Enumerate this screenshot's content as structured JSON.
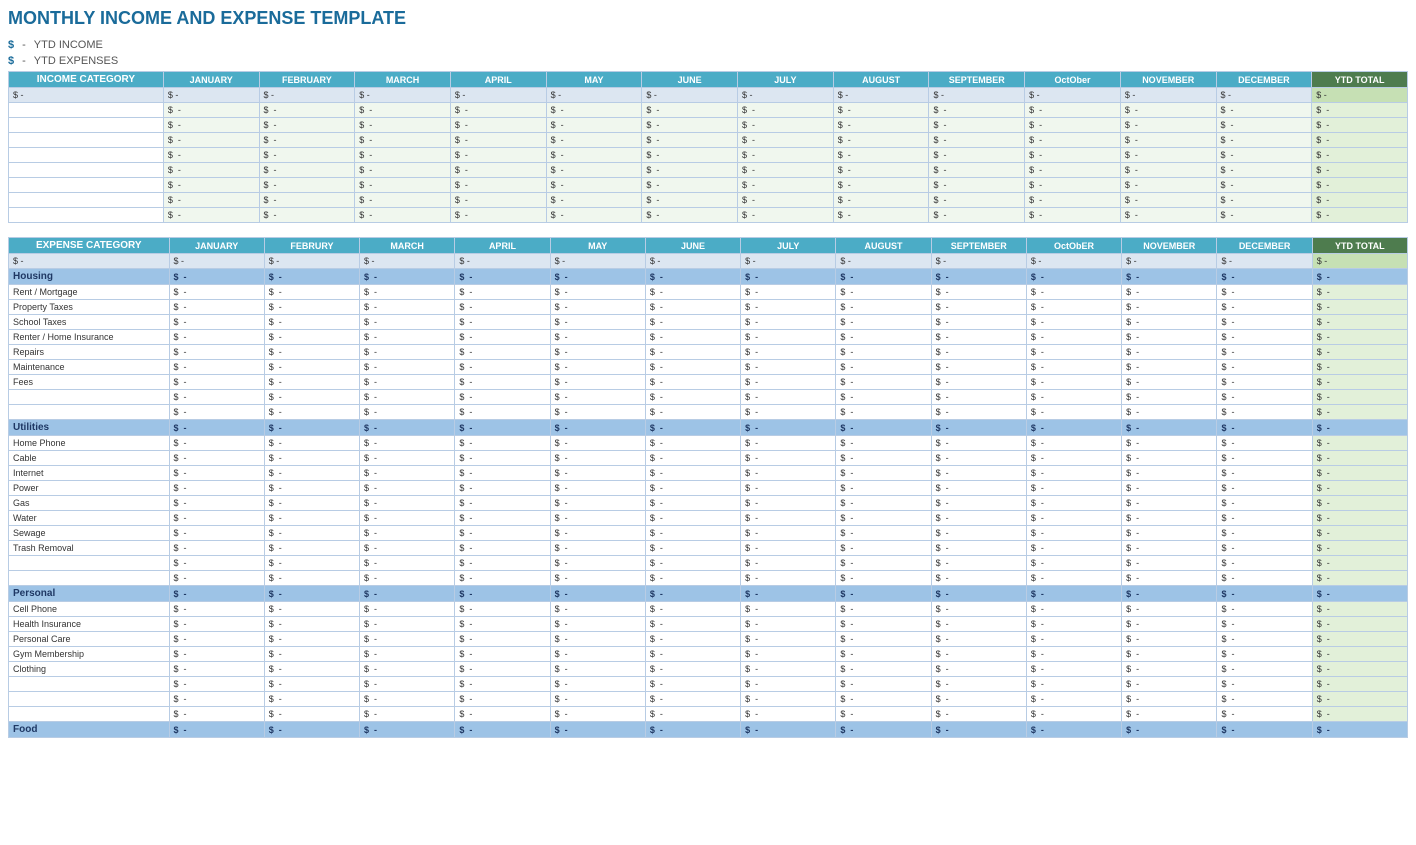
{
  "title": "MONTHLY INCOME AND EXPENSE TEMPLATE",
  "ytd_income_label": "YTD INCOME",
  "ytd_expenses_label": "YTD EXPENSES",
  "dollar_sign": "$",
  "dash": "-",
  "months": [
    "JANUARY",
    "FEBRUARY",
    "MARCH",
    "APRIL",
    "MAY",
    "JUNE",
    "JULY",
    "AUGUST",
    "SEPTEMBER",
    "OCTOBER",
    "NOVEMBER",
    "DECEMBER"
  ],
  "expense_months": [
    "JANUARY",
    "FEBRURY",
    "MARCH",
    "APRIL",
    "MAY",
    "JUNE",
    "JULY",
    "AUGUST",
    "SEPTEMBER",
    "OCTOBER",
    "NOVEMBER",
    "DECEMBER"
  ],
  "ytd_total": "YTD TOTAL",
  "income_category": "INCOME CATEGORY",
  "expense_category": "EXPENSE CATEGORY",
  "income_rows": 8,
  "expense_sections": [
    {
      "name": "Housing",
      "items": [
        "Rent / Mortgage",
        "Property Taxes",
        "School Taxes",
        "Renter / Home Insurance",
        "Repairs",
        "Maintenance",
        "Fees",
        "",
        ""
      ]
    },
    {
      "name": "Utilities",
      "items": [
        "Home Phone",
        "Cable",
        "Internet",
        "Power",
        "Gas",
        "Water",
        "Sewage",
        "Trash Removal",
        "",
        ""
      ]
    },
    {
      "name": "Personal",
      "items": [
        "Cell Phone",
        "Health Insurance",
        "Personal Care",
        "Gym Membership",
        "Clothing",
        "",
        "",
        ""
      ]
    },
    {
      "name": "Food",
      "items": []
    }
  ]
}
